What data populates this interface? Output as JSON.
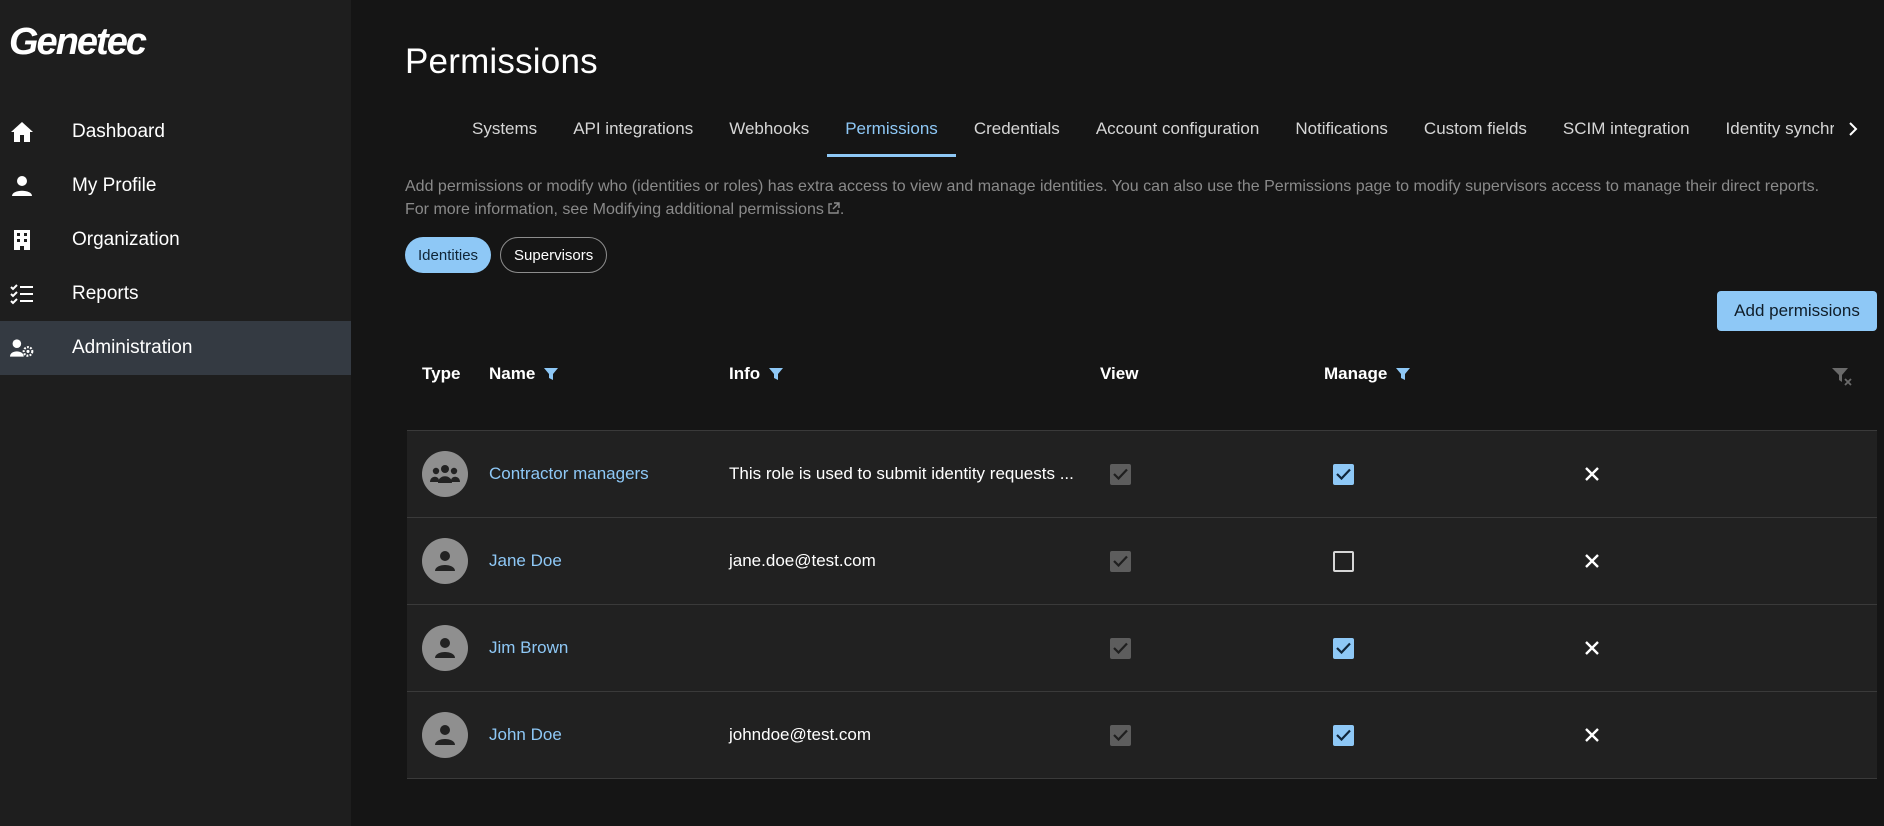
{
  "app": {
    "logo_text": "Genetec"
  },
  "sidebar": {
    "items": [
      {
        "label": "Dashboard",
        "icon": "home-icon"
      },
      {
        "label": "My Profile",
        "icon": "person-icon"
      },
      {
        "label": "Organization",
        "icon": "building-icon"
      },
      {
        "label": "Reports",
        "icon": "checklist-icon"
      },
      {
        "label": "Administration",
        "icon": "user-gear-icon",
        "active": true
      }
    ]
  },
  "page": {
    "title": "Permissions",
    "tabs": [
      {
        "label": "Systems"
      },
      {
        "label": "API integrations"
      },
      {
        "label": "Webhooks"
      },
      {
        "label": "Permissions",
        "active": true
      },
      {
        "label": "Credentials"
      },
      {
        "label": "Account configuration"
      },
      {
        "label": "Notifications"
      },
      {
        "label": "Custom fields"
      },
      {
        "label": "SCIM integration"
      },
      {
        "label": "Identity synchro"
      }
    ],
    "description_line1": "Add permissions or modify who (identities or roles) has extra access to view and manage identities. You can also use the Permissions page to modify supervisors access to manage their direct reports.",
    "description_line2": "For more information, see Modifying additional permissions",
    "pills": {
      "identities": "Identities",
      "supervisors": "Supervisors"
    },
    "add_button": "Add permissions"
  },
  "table": {
    "headers": {
      "type": "Type",
      "name": "Name",
      "info": "Info",
      "view": "View",
      "manage": "Manage"
    },
    "rows": [
      {
        "type": "group-icon",
        "name": "Contractor managers",
        "info": "This role is used to submit identity requests ...",
        "view": true,
        "manage": true
      },
      {
        "type": "person-icon",
        "name": "Jane Doe",
        "info": "jane.doe@test.com",
        "view": true,
        "manage": false
      },
      {
        "type": "person-icon",
        "name": "Jim Brown",
        "info": "",
        "view": true,
        "manage": true
      },
      {
        "type": "person-icon",
        "name": "John Doe",
        "info": "johndoe@test.com",
        "view": true,
        "manage": true
      }
    ]
  },
  "colors": {
    "accent": "#8ec8f6",
    "sidebar_bg": "#1e1e1e",
    "main_bg": "#151515",
    "row_bg": "#212121",
    "active_nav": "#343a42"
  }
}
